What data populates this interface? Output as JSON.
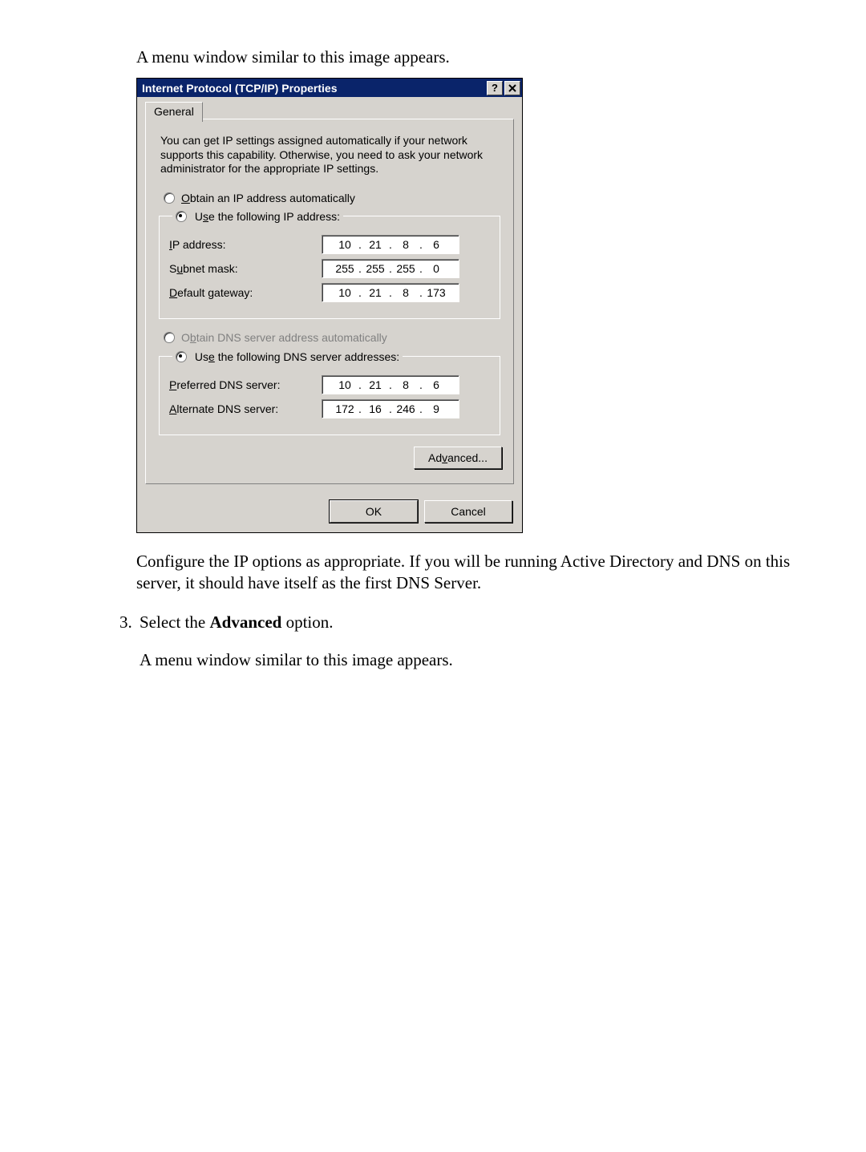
{
  "doc": {
    "intro": "A menu window similar to this image appears.",
    "after_dialog": "Configure the IP options as appropriate. If you will be running Active Directory and DNS on this server, it should have itself as the first DNS Server.",
    "step3_prefix": "Select the ",
    "step3_bold": "Advanced",
    "step3_suffix": " option.",
    "after_step3": "A menu window similar to this image appears.",
    "list_start": 3
  },
  "dialog": {
    "title": "Internet Protocol (TCP/IP) Properties",
    "help_glyph": "?",
    "tab_label": "General",
    "description": "You can get IP settings assigned automatically if your network supports this capability. Otherwise, you need to ask your network administrator for the appropriate IP settings.",
    "ip_group": {
      "auto_label_pre": "O",
      "auto_label_rest": "btain an IP address automatically",
      "manual_label_pre": "s",
      "manual_label_preU": "U",
      "manual_label_rest": "e the following IP address:",
      "auto_selected": false,
      "rows": {
        "ip": {
          "label_pre": "I",
          "label_rest": "P address:",
          "value": [
            "10",
            "21",
            "8",
            "6"
          ]
        },
        "mask": {
          "label_pre": "S",
          "label_rest": "ubnet mask:",
          "value": [
            "255",
            "255",
            "255",
            "0"
          ]
        },
        "gateway": {
          "label_pre": "D",
          "label_rest": "efault gateway:",
          "value": [
            "10",
            "21",
            "8",
            "173"
          ]
        }
      }
    },
    "dns_group": {
      "auto_label_pre": "b",
      "auto_label_preO": "O",
      "auto_label_rest": "tain DNS server address automatically",
      "manual_label_pre": "e",
      "manual_label_preU": "Us",
      "manual_label_rest": " the following DNS server addresses:",
      "auto_selected": false,
      "rows": {
        "pref": {
          "label_pre": "P",
          "label_rest": "referred DNS server:",
          "value": [
            "10",
            "21",
            "8",
            "6"
          ]
        },
        "alt": {
          "label_pre": "A",
          "label_rest": "lternate DNS server:",
          "value": [
            "172",
            "16",
            "246",
            "9"
          ]
        }
      }
    },
    "buttons": {
      "advanced_pre": "Ad",
      "advanced_u": "v",
      "advanced_rest": "anced...",
      "ok": "OK",
      "cancel": "Cancel"
    }
  }
}
